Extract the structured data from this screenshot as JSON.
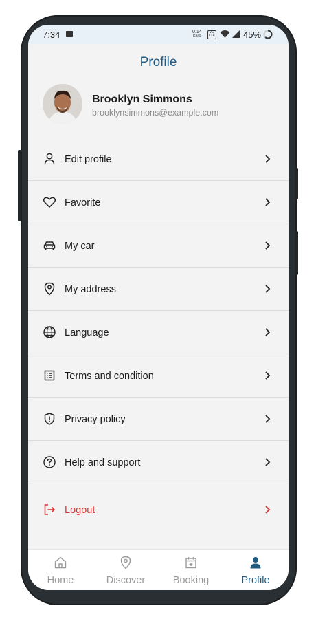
{
  "status_bar": {
    "time": "7:34",
    "speed_value": "0.14",
    "speed_unit": "KB/S",
    "volte": "VO LTE",
    "battery": "45%"
  },
  "page": {
    "title": "Profile"
  },
  "user": {
    "name": "Brooklyn Simmons",
    "email": "brooklynsimmons@example.com"
  },
  "menu": [
    {
      "label": "Edit profile",
      "icon": "person-icon"
    },
    {
      "label": "Favorite",
      "icon": "heart-icon"
    },
    {
      "label": "My car",
      "icon": "car-icon"
    },
    {
      "label": "My address",
      "icon": "location-pin-icon"
    },
    {
      "label": "Language",
      "icon": "globe-icon"
    },
    {
      "label": "Terms and condition",
      "icon": "document-list-icon"
    },
    {
      "label": "Privacy policy",
      "icon": "shield-icon"
    },
    {
      "label": "Help and support",
      "icon": "help-circle-icon"
    },
    {
      "label": "Logout",
      "icon": "logout-icon"
    }
  ],
  "tabs": [
    {
      "label": "Home",
      "icon": "home-icon",
      "active": false
    },
    {
      "label": "Discover",
      "icon": "location-pin-icon",
      "active": false
    },
    {
      "label": "Booking",
      "icon": "calendar-add-icon",
      "active": false
    },
    {
      "label": "Profile",
      "icon": "person-icon",
      "active": true
    }
  ],
  "colors": {
    "accent": "#1e5a82",
    "logout": "#d93636",
    "background": "#f3f3f3",
    "status_bar": "#e8f1f8"
  }
}
